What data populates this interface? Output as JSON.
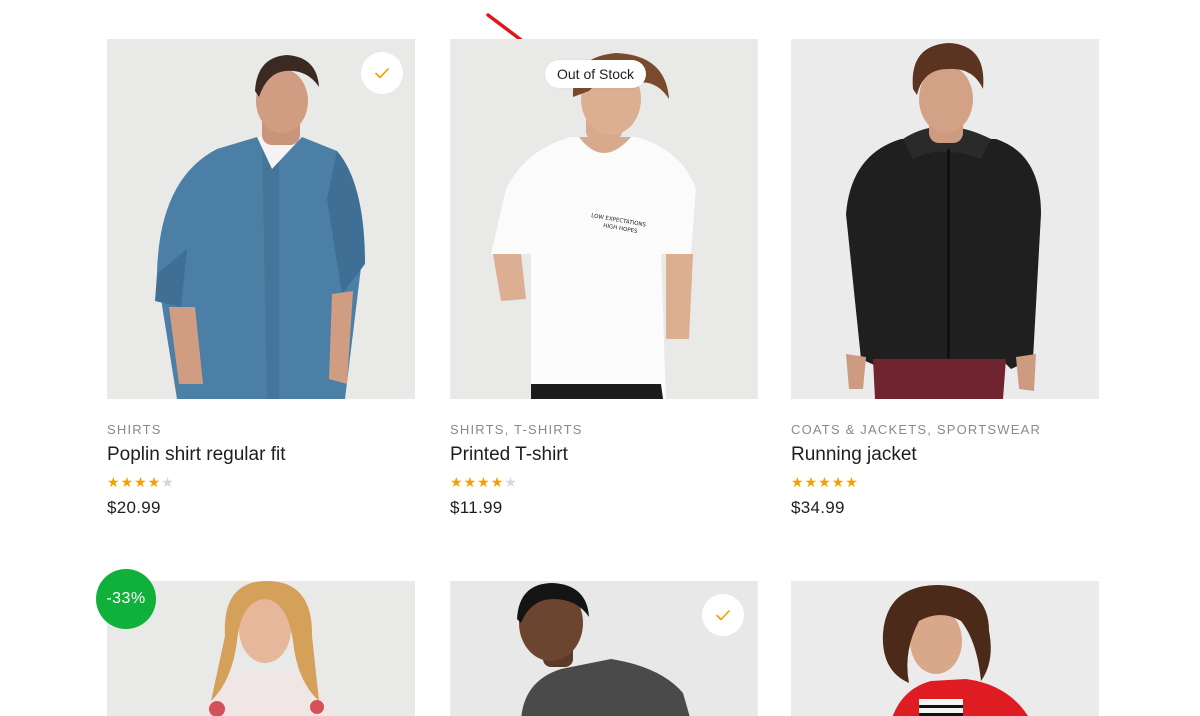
{
  "products": [
    {
      "category": [
        "Shirts"
      ],
      "title": "Poplin shirt regular fit",
      "rating": 4,
      "price": "$20.99",
      "image_alt": "man in blue short-sleeve shirt"
    },
    {
      "category": [
        "Shirts",
        "T-shirts"
      ],
      "title": "Printed T-shirt",
      "rating": 4,
      "price": "$11.99",
      "image_alt": "man in white printed t-shirt",
      "stock_label": "Out of Stock",
      "print_text": [
        "LOW EXPECTATIONS",
        "HIGH HOPES"
      ]
    },
    {
      "category": [
        "Coats & Jackets",
        "Sportswear"
      ],
      "title": "Running jacket",
      "rating": 5,
      "price": "$34.99",
      "image_alt": "man in black running jacket"
    }
  ],
  "sale_badge": "-33%",
  "check_icon": "check-icon",
  "colors": {
    "star": "#f3a100",
    "star_empty": "#d6d6d6",
    "sale": "#10b13b",
    "check": "#f3a100",
    "arrow": "#e0161b"
  }
}
